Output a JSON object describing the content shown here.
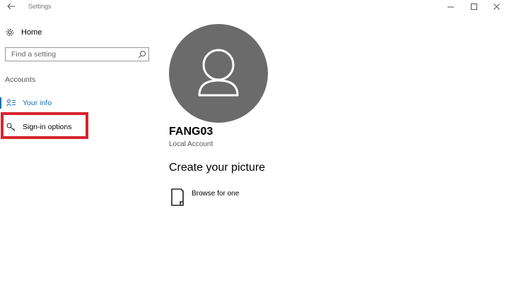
{
  "window": {
    "title": "Settings"
  },
  "sidebar": {
    "home_label": "Home",
    "search": {
      "placeholder": "Find a setting",
      "value": ""
    },
    "section_label": "Accounts",
    "items": [
      {
        "label": "Your info",
        "icon": "person-card-icon",
        "selected": true
      },
      {
        "label": "Sign-in options",
        "icon": "key-icon",
        "selected": false,
        "highlighted": true
      }
    ]
  },
  "main": {
    "username": "FANG03",
    "account_type": "Local Account",
    "create_picture_heading": "Create your picture",
    "browse_label": "Browse for one"
  },
  "colors": {
    "accent": "#1a6fb0",
    "highlight": "#d9232d",
    "avatar_bg": "#6b6b6b"
  }
}
